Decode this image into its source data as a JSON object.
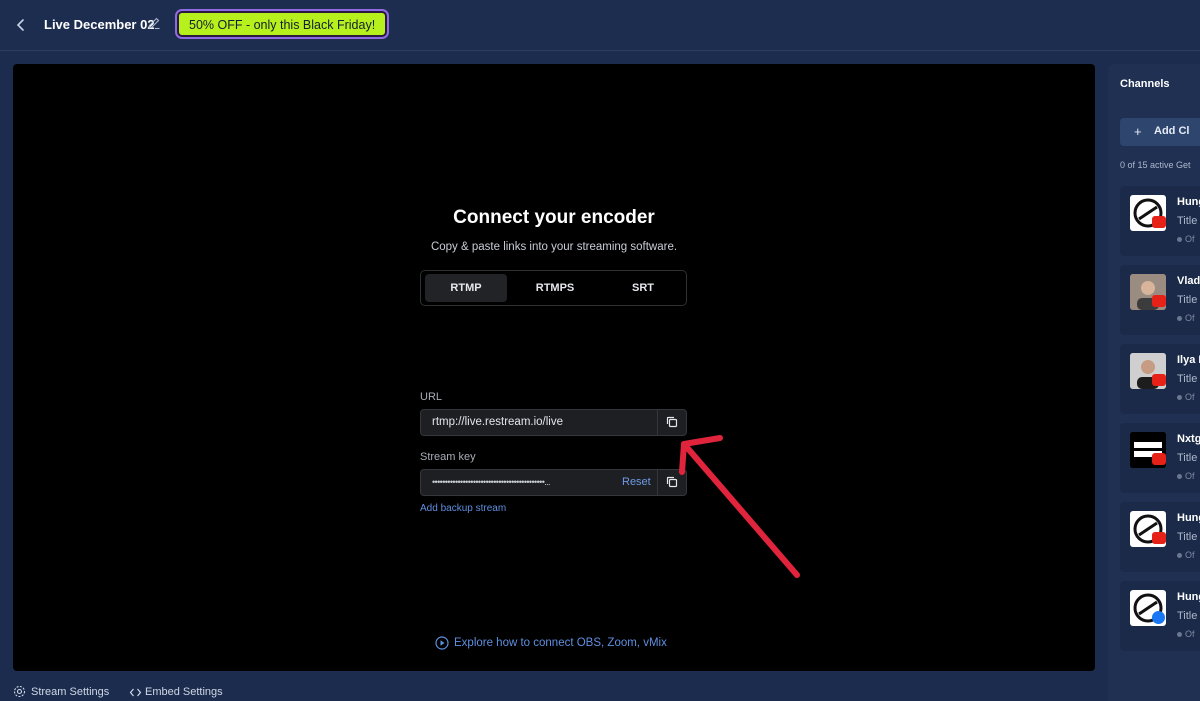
{
  "header": {
    "stream_title": "Live December 02",
    "promo": "50% OFF - only this Black Friday!"
  },
  "encoder": {
    "title": "Connect your encoder",
    "subtitle": "Copy & paste links into your streaming software.",
    "tabs": [
      "RTMP",
      "RTMPS",
      "SRT"
    ],
    "active_tab": "RTMP",
    "url_label": "URL",
    "url_value": "rtmp://live.restream.io/live",
    "key_label": "Stream key",
    "key_value": "••••••••••••••••••••••••••••••••••••••••••••...",
    "reset_label": "Reset",
    "backup_link": "Add backup stream",
    "explore_link": "Explore how to connect OBS, Zoom, vMix"
  },
  "bottom": {
    "stream_settings": "Stream Settings",
    "embed_settings": "Embed Settings"
  },
  "sidebar": {
    "title": "Channels",
    "add_label": "Add Cl",
    "count_text": "0 of 15 active Get",
    "channels": [
      {
        "name": "Hung",
        "title": "Title",
        "status": "Of",
        "platform": "youtube"
      },
      {
        "name": "Vlad",
        "title": "Title",
        "status": "Of",
        "platform": "youtube"
      },
      {
        "name": "Ilya I",
        "title": "Title",
        "status": "Of",
        "platform": "youtube"
      },
      {
        "name": "Nxtg",
        "title": "Title",
        "status": "Of",
        "platform": "youtube"
      },
      {
        "name": "Hung",
        "title": "Title",
        "status": "Of",
        "platform": "youtube"
      },
      {
        "name": "Hung",
        "title": "Title",
        "status": "Of",
        "platform": "facebook"
      }
    ]
  },
  "colors": {
    "accent_blue": "#5f8fe0",
    "promo_green": "#b6f01d",
    "arrow_red": "#e0243c",
    "youtube_red": "#e62117",
    "facebook_blue": "#1877f2"
  }
}
